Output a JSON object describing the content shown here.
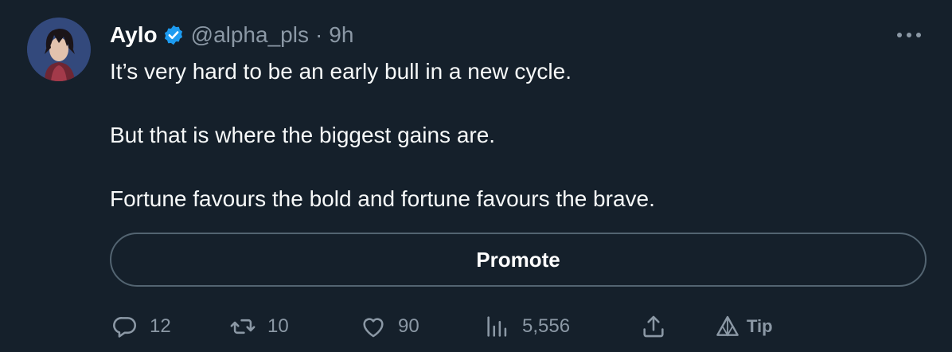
{
  "author": {
    "name": "Aylo",
    "handle": "@alpha_pls",
    "separator": "·",
    "time": "9h",
    "verified": true
  },
  "tweet": {
    "paragraphs": [
      "It’s very hard to be an early bull in a new cycle.",
      "But that is where the biggest gains are.",
      "Fortune favours the bold and fortune favours the brave."
    ]
  },
  "promote_label": "Promote",
  "actions": {
    "replies": "12",
    "retweets": "10",
    "likes": "90",
    "views": "5,556",
    "tip_label": "Tip"
  },
  "colors": {
    "background": "#15202b",
    "text": "#ffffff",
    "secondary": "#8b98a5",
    "verified": "#1d9bf0",
    "border": "#536471"
  },
  "icons": {
    "verified": "verified-badge-icon",
    "more": "more-icon",
    "reply": "reply-icon",
    "retweet": "retweet-icon",
    "like": "heart-icon",
    "views": "views-icon",
    "share": "share-icon",
    "tip": "tip-icon"
  }
}
